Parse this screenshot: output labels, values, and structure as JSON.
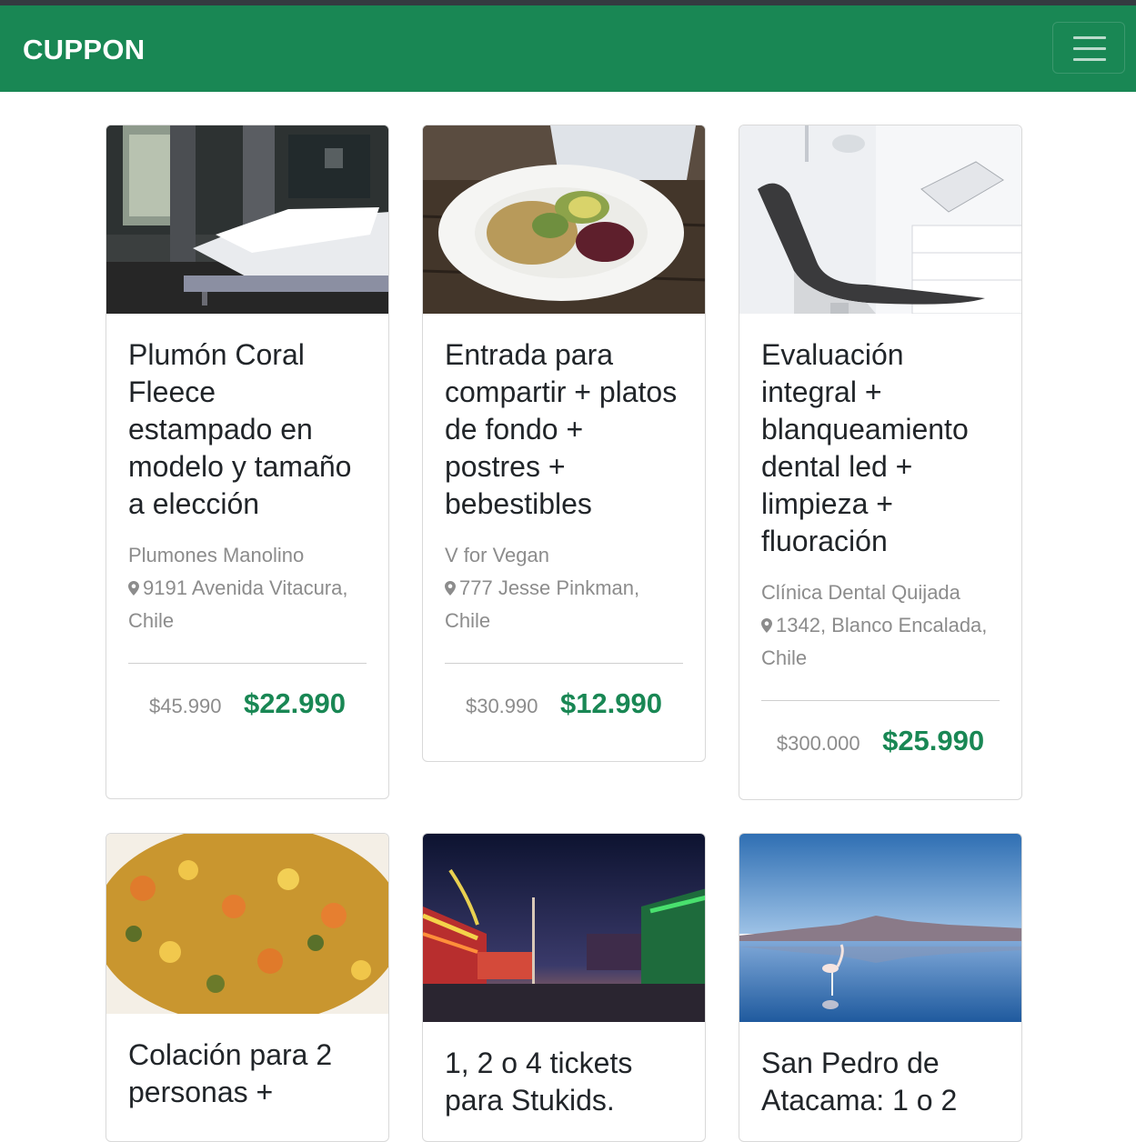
{
  "brand": "CUPPON",
  "deals": [
    {
      "title": "Plumón Coral Fleece estampado en modelo y tamaño a elección",
      "merchant": "Plumones Manolino",
      "address": "9191 Avenida Vitacura, Chile",
      "old_price": "$45.990",
      "new_price": "$22.990",
      "image": "bedroom"
    },
    {
      "title": "Entrada para compartir + platos de fondo + postres + bebestibles",
      "merchant": "V for Vegan",
      "address": "777 Jesse Pinkman, Chile",
      "old_price": "$30.990",
      "new_price": "$12.990",
      "image": "vegan-plate"
    },
    {
      "title": "Evaluación integral + blanqueamiento dental led + limpieza + fluoración",
      "merchant": "Clínica Dental Quijada",
      "address": "1342, Blanco Encalada, Chile",
      "old_price": "$300.000",
      "new_price": "$25.990",
      "image": "dental-chair"
    },
    {
      "title": "Colación para 2 personas +",
      "image": "food-dish"
    },
    {
      "title": "1, 2 o 4 tickets para Stukids.",
      "image": "amusement-park"
    },
    {
      "title": "San Pedro de Atacama: 1 o 2",
      "image": "flamingo-lagoon"
    }
  ],
  "colors": {
    "navbar": "#198754",
    "price": "#198754",
    "muted": "#8c8c8c"
  }
}
